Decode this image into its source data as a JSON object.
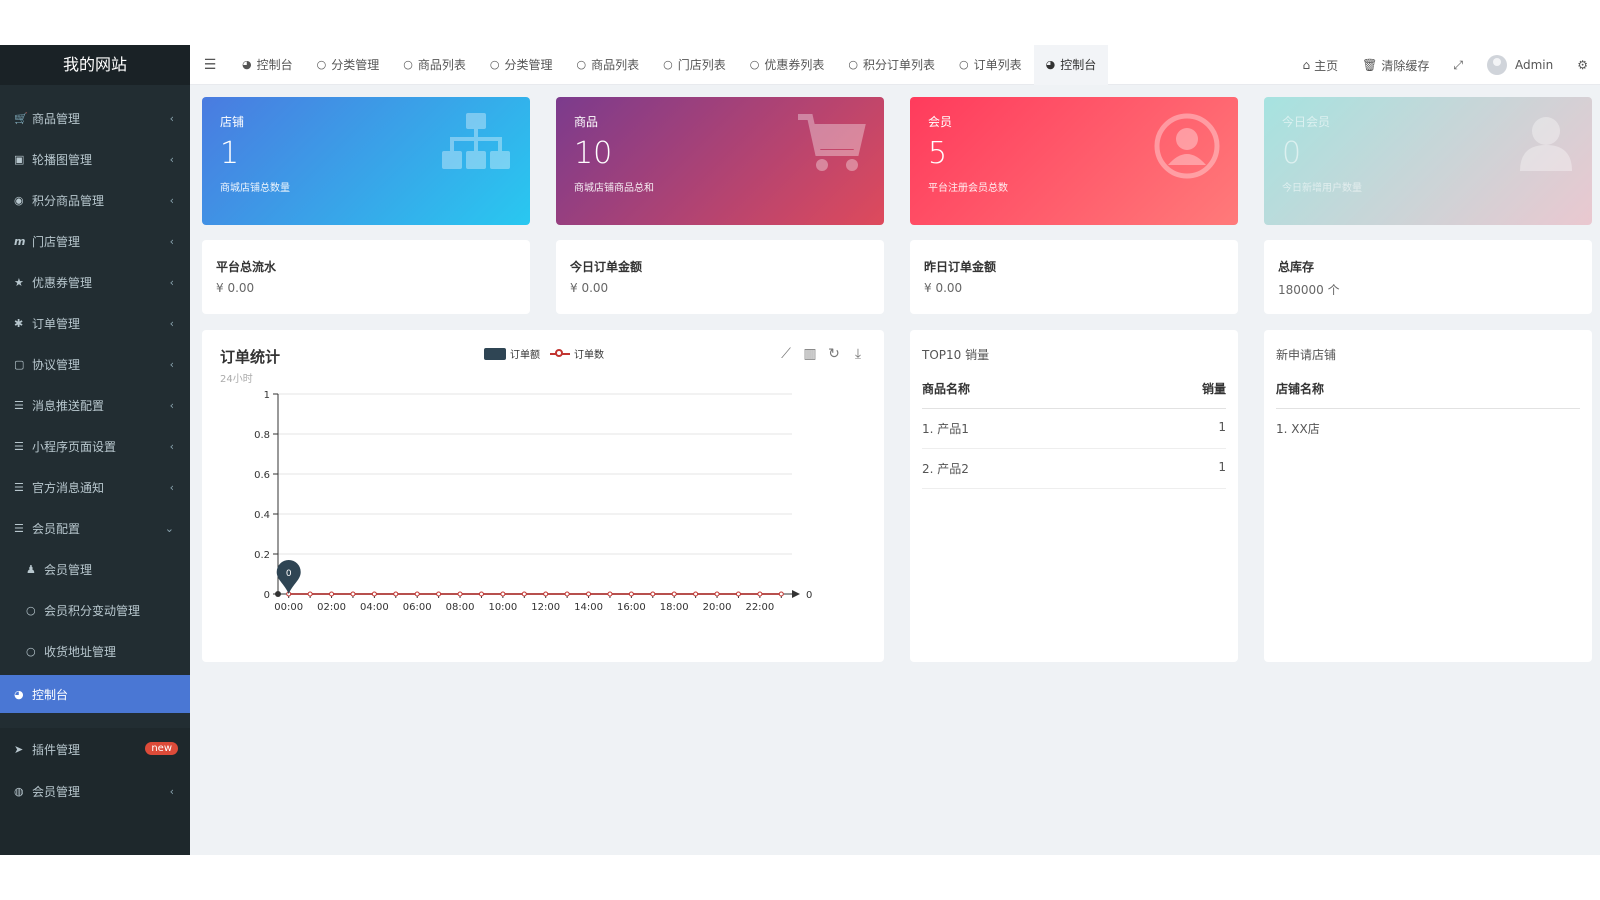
{
  "brand": "我的网站",
  "sidebar": {
    "items": [
      {
        "icon": "cart-icon",
        "glyph": "🛒",
        "label": "商品管理"
      },
      {
        "icon": "image-icon",
        "glyph": "▣",
        "label": "轮播图管理"
      },
      {
        "icon": "gift-icon",
        "glyph": "◉",
        "label": "积分商品管理"
      },
      {
        "icon": "store-icon",
        "glyph": "m",
        "label": "门店管理"
      },
      {
        "icon": "star-icon",
        "glyph": "★",
        "label": "优惠券管理"
      },
      {
        "icon": "settings-icon",
        "glyph": "✱",
        "label": "订单管理"
      },
      {
        "icon": "file-icon",
        "glyph": "▢",
        "label": "协议管理"
      },
      {
        "icon": "list-icon",
        "glyph": "☰",
        "label": "消息推送配置"
      },
      {
        "icon": "list-icon",
        "glyph": "☰",
        "label": "小程序页面设置"
      },
      {
        "icon": "list-icon",
        "glyph": "☰",
        "label": "官方消息通知"
      },
      {
        "icon": "list-icon",
        "glyph": "☰",
        "label": "会员配置"
      }
    ],
    "subitems": [
      {
        "icon": "user-icon",
        "glyph": "♟",
        "label": "会员管理"
      },
      {
        "icon": "circle-icon",
        "glyph": "○",
        "label": "会员积分变动管理"
      },
      {
        "icon": "circle-icon",
        "glyph": "○",
        "label": "收货地址管理"
      }
    ],
    "active": {
      "icon": "dashboard-icon",
      "glyph": "◕",
      "label": "控制台"
    },
    "plugin": {
      "icon": "rocket-icon",
      "glyph": "➤",
      "label": "插件管理",
      "badge": "new"
    },
    "member": {
      "icon": "user-circle-icon",
      "glyph": "◍",
      "label": "会员管理"
    }
  },
  "topbar": {
    "tabs": [
      {
        "icon": "dashboard-icon",
        "glyph": "◕",
        "label": "控制台"
      },
      {
        "icon": "circle-icon",
        "glyph": "○",
        "label": "分类管理"
      },
      {
        "icon": "circle-icon",
        "glyph": "○",
        "label": "商品列表"
      },
      {
        "icon": "circle-icon",
        "glyph": "○",
        "label": "分类管理"
      },
      {
        "icon": "circle-icon",
        "glyph": "○",
        "label": "商品列表"
      },
      {
        "icon": "circle-icon",
        "glyph": "○",
        "label": "门店列表"
      },
      {
        "icon": "circle-icon",
        "glyph": "○",
        "label": "优惠券列表"
      },
      {
        "icon": "circle-icon",
        "glyph": "○",
        "label": "积分订单列表"
      },
      {
        "icon": "circle-icon",
        "glyph": "○",
        "label": "订单列表"
      },
      {
        "icon": "dashboard-icon",
        "glyph": "◕",
        "label": "控制台"
      }
    ],
    "home": "主页",
    "clear_cache": "清除缓存",
    "user": "Admin"
  },
  "stats": [
    {
      "label": "店铺",
      "value": "1",
      "desc": "商城店铺总数量"
    },
    {
      "label": "商品",
      "value": "10",
      "desc": "商城店铺商品总和"
    },
    {
      "label": "会员",
      "value": "5",
      "desc": "平台注册会员总数"
    },
    {
      "label": "今日会员",
      "value": "0",
      "desc": "今日新增用户数量"
    }
  ],
  "info": [
    {
      "title": "平台总流水",
      "value": "¥ 0.00"
    },
    {
      "title": "今日订单金额",
      "value": "¥ 0.00"
    },
    {
      "title": "昨日订单金额",
      "value": "¥ 0.00"
    },
    {
      "title": "总库存",
      "value": "180000 个"
    }
  ],
  "chart_panel": {
    "title": "订单统计",
    "subtitle": "24小时",
    "legend_amount": "订单额",
    "legend_count": "订单数"
  },
  "chart_data": {
    "type": "line",
    "categories": [
      "00:00",
      "01:00",
      "02:00",
      "03:00",
      "04:00",
      "05:00",
      "06:00",
      "07:00",
      "08:00",
      "09:00",
      "10:00",
      "11:00",
      "12:00",
      "13:00",
      "14:00",
      "15:00",
      "16:00",
      "17:00",
      "18:00",
      "19:00",
      "20:00",
      "21:00",
      "22:00",
      "23:00"
    ],
    "x_tick_labels": [
      "00:00",
      "02:00",
      "04:00",
      "06:00",
      "08:00",
      "10:00",
      "12:00",
      "14:00",
      "16:00",
      "18:00",
      "20:00",
      "22:00"
    ],
    "series": [
      {
        "name": "订单额",
        "values": [
          0,
          0,
          0,
          0,
          0,
          0,
          0,
          0,
          0,
          0,
          0,
          0,
          0,
          0,
          0,
          0,
          0,
          0,
          0,
          0,
          0,
          0,
          0,
          0
        ]
      },
      {
        "name": "订单数",
        "values": [
          0,
          0,
          0,
          0,
          0,
          0,
          0,
          0,
          0,
          0,
          0,
          0,
          0,
          0,
          0,
          0,
          0,
          0,
          0,
          0,
          0,
          0,
          0,
          0
        ]
      }
    ],
    "y_ticks": [
      "0",
      "0.2",
      "0.4",
      "0.6",
      "0.8",
      "1"
    ],
    "ylim": [
      0,
      1
    ],
    "marker_label": "0",
    "end_label": "0",
    "grid": true,
    "colors": {
      "amount": "#2f4554",
      "count": "#c23531"
    }
  },
  "top10": {
    "title": "TOP10 销量",
    "col_name": "商品名称",
    "col_sales": "销量",
    "rows": [
      {
        "name": "1. 产品1",
        "sales": "1"
      },
      {
        "name": "2. 产品2",
        "sales": "1"
      }
    ]
  },
  "new_shops": {
    "title": "新申请店铺",
    "col_name": "店铺名称",
    "rows": [
      {
        "name": "1. XX店"
      }
    ]
  }
}
